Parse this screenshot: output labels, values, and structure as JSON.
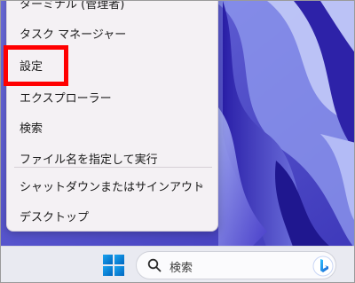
{
  "context_menu": {
    "items": [
      {
        "label": "ターミナル (管理者)"
      },
      {
        "label": "タスク マネージャー"
      },
      {
        "label": "設定"
      },
      {
        "label": "エクスプローラー"
      },
      {
        "label": "検索"
      },
      {
        "label": "ファイル名を指定して実行"
      },
      {
        "label": "シャットダウンまたはサインアウト",
        "submenu_icon": "chevron-right-icon"
      },
      {
        "label": "デスクトップ"
      }
    ]
  },
  "taskbar": {
    "start_icon": "windows-logo-icon",
    "search_icon": "search-icon",
    "search_label": "検索",
    "bing_icon": "bing-logo-icon"
  },
  "annotation": {
    "color": "#ff0000"
  },
  "colors": {
    "menu_bg": "#f4f1f4",
    "taskbar_bg": "#e9eaf1",
    "wallpaper_primary": "#4d48c8"
  }
}
